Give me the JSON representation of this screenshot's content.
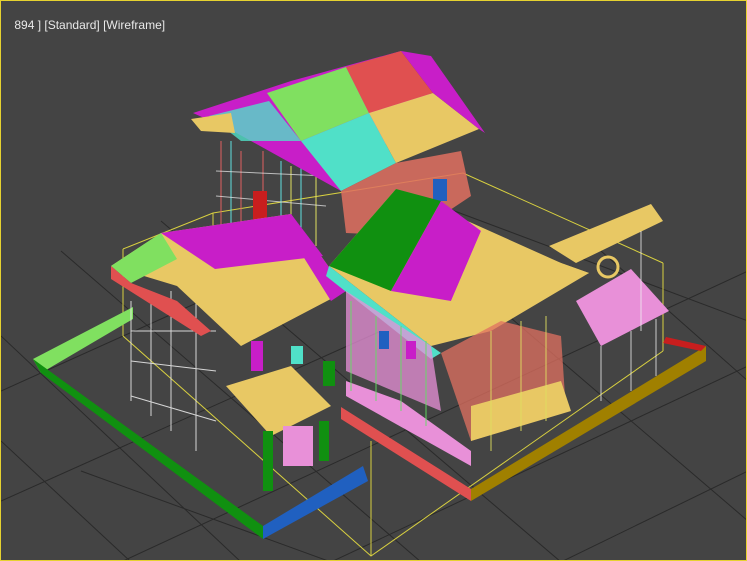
{
  "viewport": {
    "label_prefix": "894 ] ",
    "label_view": "[Standard]",
    "label_gap": " ",
    "label_mode": "[Wireframe]",
    "border_color": "#e6d230",
    "background_color": "#444444",
    "grid_color": "#2a2a2a"
  },
  "palette": {
    "magenta": "#c81ec8",
    "yellow": "#e8c864",
    "red": "#e05050",
    "green": "#109010",
    "lime": "#80e060",
    "cyan": "#50e0c8",
    "pink": "#e890d8",
    "blue": "#2060c0",
    "dark_yellow": "#a08000",
    "salmon": "#e07060"
  }
}
